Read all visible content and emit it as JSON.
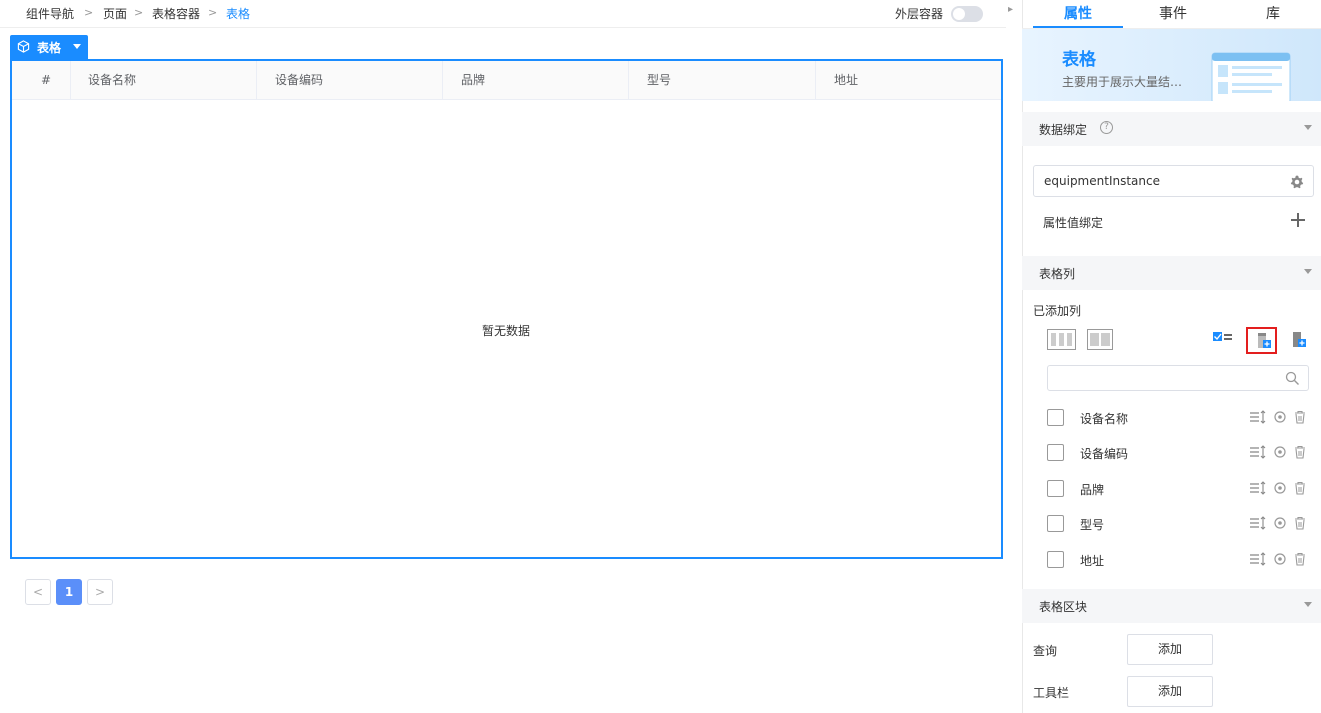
{
  "breadcrumb": [
    "组件导航",
    "页面",
    "表格容器",
    "表格"
  ],
  "topbar": {
    "outer_container_label": "外层容器"
  },
  "component_tag": {
    "label": "表格"
  },
  "table": {
    "columns": [
      "#",
      "设备名称",
      "设备编码",
      "品牌",
      "型号",
      "地址"
    ],
    "empty_text": "暂无数据"
  },
  "pagination": {
    "prev": "<",
    "current": "1",
    "next": ">"
  },
  "panel": {
    "tabs": [
      "属性",
      "事件",
      "库"
    ],
    "active_tab": "属性",
    "hero": {
      "title": "表格",
      "desc": "主要用于展示大量结…"
    },
    "data_binding": {
      "title": "数据绑定",
      "help_icon": "?",
      "value": "equipmentInstance",
      "property_binding_label": "属性值绑定"
    },
    "table_columns": {
      "title": "表格列",
      "added_label": "已添加列",
      "search_placeholder": "",
      "items": [
        {
          "label": "设备名称"
        },
        {
          "label": "设备编码"
        },
        {
          "label": "品牌"
        },
        {
          "label": "型号"
        },
        {
          "label": "地址"
        }
      ]
    },
    "table_blocks": {
      "title": "表格区块",
      "rows": [
        {
          "label": "查询",
          "button": "添加"
        },
        {
          "label": "工具栏",
          "button": "添加"
        }
      ]
    }
  },
  "colors": {
    "accent": "#1a8cff",
    "highlight": "#e31e1e",
    "page_active": "#5b8ff9"
  }
}
